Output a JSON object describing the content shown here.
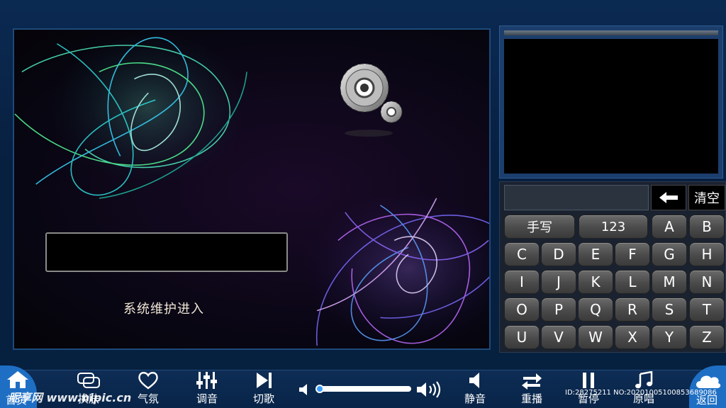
{
  "main": {
    "maintenance_label": "系统维护进入"
  },
  "keyboard": {
    "clear_label": "清空",
    "handwrite_label": "手写",
    "numbers_label": "123",
    "letters": [
      "A",
      "B",
      "C",
      "D",
      "E",
      "F",
      "G",
      "H",
      "I",
      "J",
      "K",
      "L",
      "M",
      "N",
      "O",
      "P",
      "Q",
      "R",
      "S",
      "T",
      "U",
      "V",
      "W",
      "X",
      "Y",
      "Z"
    ]
  },
  "bottom_bar": {
    "home_label": "首页",
    "skin_label": "换肤",
    "atmosphere_label": "气氛",
    "tune_label": "调音",
    "next_label": "切歌",
    "mute_label": "静音",
    "replay_label": "重播",
    "pause_label": "暂停",
    "original_label": "原唱",
    "return_label": "返回",
    "volume_level": 0.02
  },
  "overlay": {
    "watermark": "昵享网 www.nipic.cn",
    "id_text": "ID:28275211 NO:20201005100853689086"
  },
  "icons": [
    "gear-icon",
    "backspace-arrow-icon",
    "home-icon",
    "skin-icon",
    "heart-icon",
    "equalizer-icon",
    "next-track-icon",
    "volume-low-icon",
    "volume-high-icon",
    "mute-speaker-icon",
    "replay-arrows-icon",
    "pause-icon",
    "music-note-icon",
    "cloud-icon"
  ]
}
